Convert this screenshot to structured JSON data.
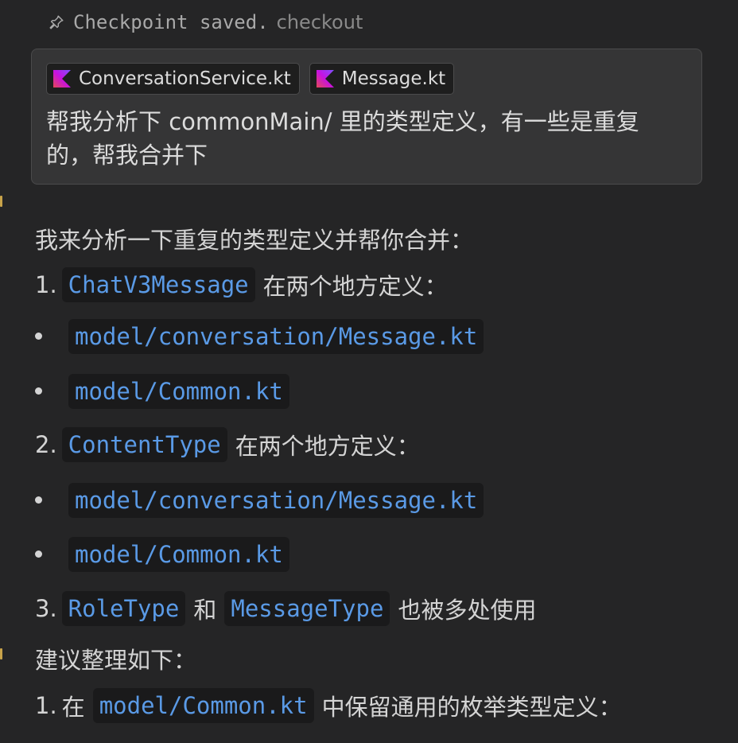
{
  "checkpoint": {
    "text": "Checkpoint saved.",
    "link": "checkout",
    "icon": "pin-icon"
  },
  "user_message": {
    "attachments": [
      {
        "name": "ConversationService.kt",
        "icon": "kotlin-file-icon"
      },
      {
        "name": "Message.kt",
        "icon": "kotlin-file-icon"
      }
    ],
    "text": "帮我分析下 commonMain/ 里的类型定义，有一些是重复的，帮我合并下"
  },
  "reply": {
    "intro": "我来分析一下重复的类型定义并帮你合并：",
    "item1": {
      "num": "1.",
      "code": "ChatV3Message",
      "text": "在两个地方定义："
    },
    "item1_bullets": [
      "model/conversation/Message.kt",
      "model/Common.kt"
    ],
    "item2": {
      "num": "2.",
      "code": "ContentType",
      "text": "在两个地方定义："
    },
    "item2_bullets": [
      "model/conversation/Message.kt",
      "model/Common.kt"
    ],
    "item3": {
      "num": "3.",
      "code_a": "RoleType",
      "and": "和",
      "code_b": "MessageType",
      "text": "也被多处使用"
    },
    "suggestion": "建议整理如下：",
    "step1": {
      "num": "1.",
      "prefix": "在",
      "code": "model/Common.kt",
      "text": "中保留通用的枚举类型定义："
    }
  },
  "colors": {
    "background": "#252526",
    "user_box": "#353536",
    "code_text": "#5a9ae6",
    "code_bg": "#1a1a1b",
    "left_marker": "#c8a34a"
  }
}
